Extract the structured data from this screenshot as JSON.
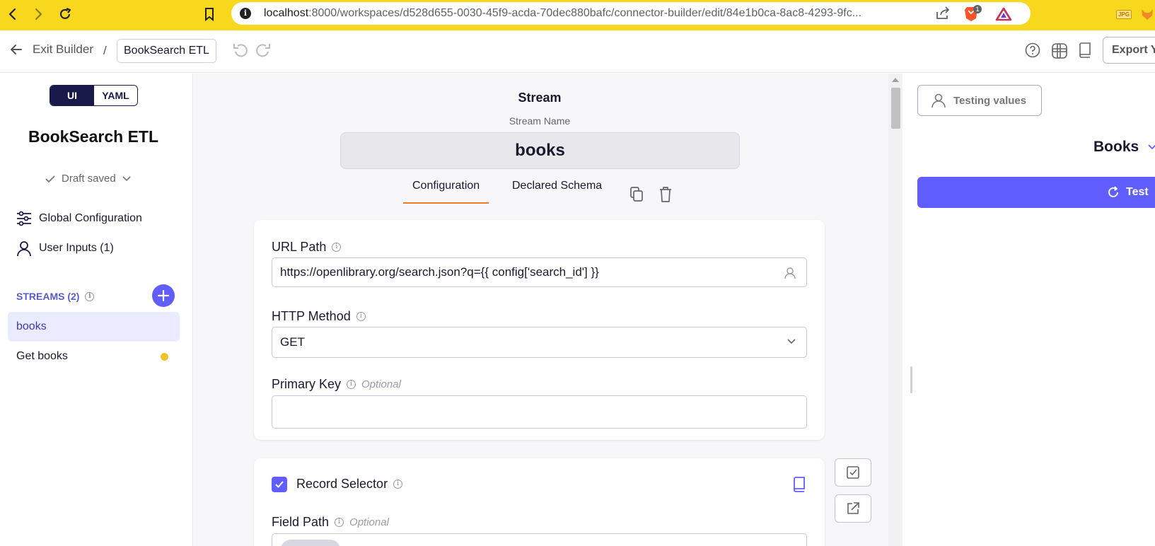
{
  "browser": {
    "url_host": "localhost",
    "url_rest": ":8000/workspaces/d528d655-0030-45f9-acda-70dec880bafc/connector-builder/edit/84e1b0ca-8ac8-4293-9fc...",
    "brave_badge": "1",
    "ext_label": "JPG"
  },
  "header": {
    "exit_label": "Exit Builder",
    "separator": "/",
    "connector_name": "BookSearch ETL",
    "export_label": "Export Y"
  },
  "sidebar": {
    "toggle": {
      "ui": "UI",
      "yaml": "YAML"
    },
    "title": "BookSearch ETL",
    "draft_status": "Draft saved",
    "global_config": "Global Configuration",
    "user_inputs": "User Inputs (1)",
    "streams_heading": "STREAMS (2)",
    "streams": [
      {
        "label": "books"
      },
      {
        "label": "Get books"
      }
    ]
  },
  "stream": {
    "heading": "Stream",
    "name_label": "Stream Name",
    "name_value": "books",
    "tabs": [
      "Configuration",
      "Declared Schema"
    ]
  },
  "form": {
    "url_path_label": "URL Path",
    "url_path_value": "https://openlibrary.org/search.json?q={{ config['search_id'] }}",
    "http_method_label": "HTTP Method",
    "http_method_value": "GET",
    "primary_key_label": "Primary Key",
    "optional": "Optional",
    "record_selector_label": "Record Selector",
    "field_path_label": "Field Path"
  },
  "right_panel": {
    "testing_values": "Testing values",
    "stream_selector": "Books",
    "test_label": "Test"
  },
  "colors": {
    "browser_bar": "#f8d81c",
    "accent": "#615eff",
    "tab_underline": "#f07b24",
    "unsaved_dot": "#ecc32b"
  }
}
